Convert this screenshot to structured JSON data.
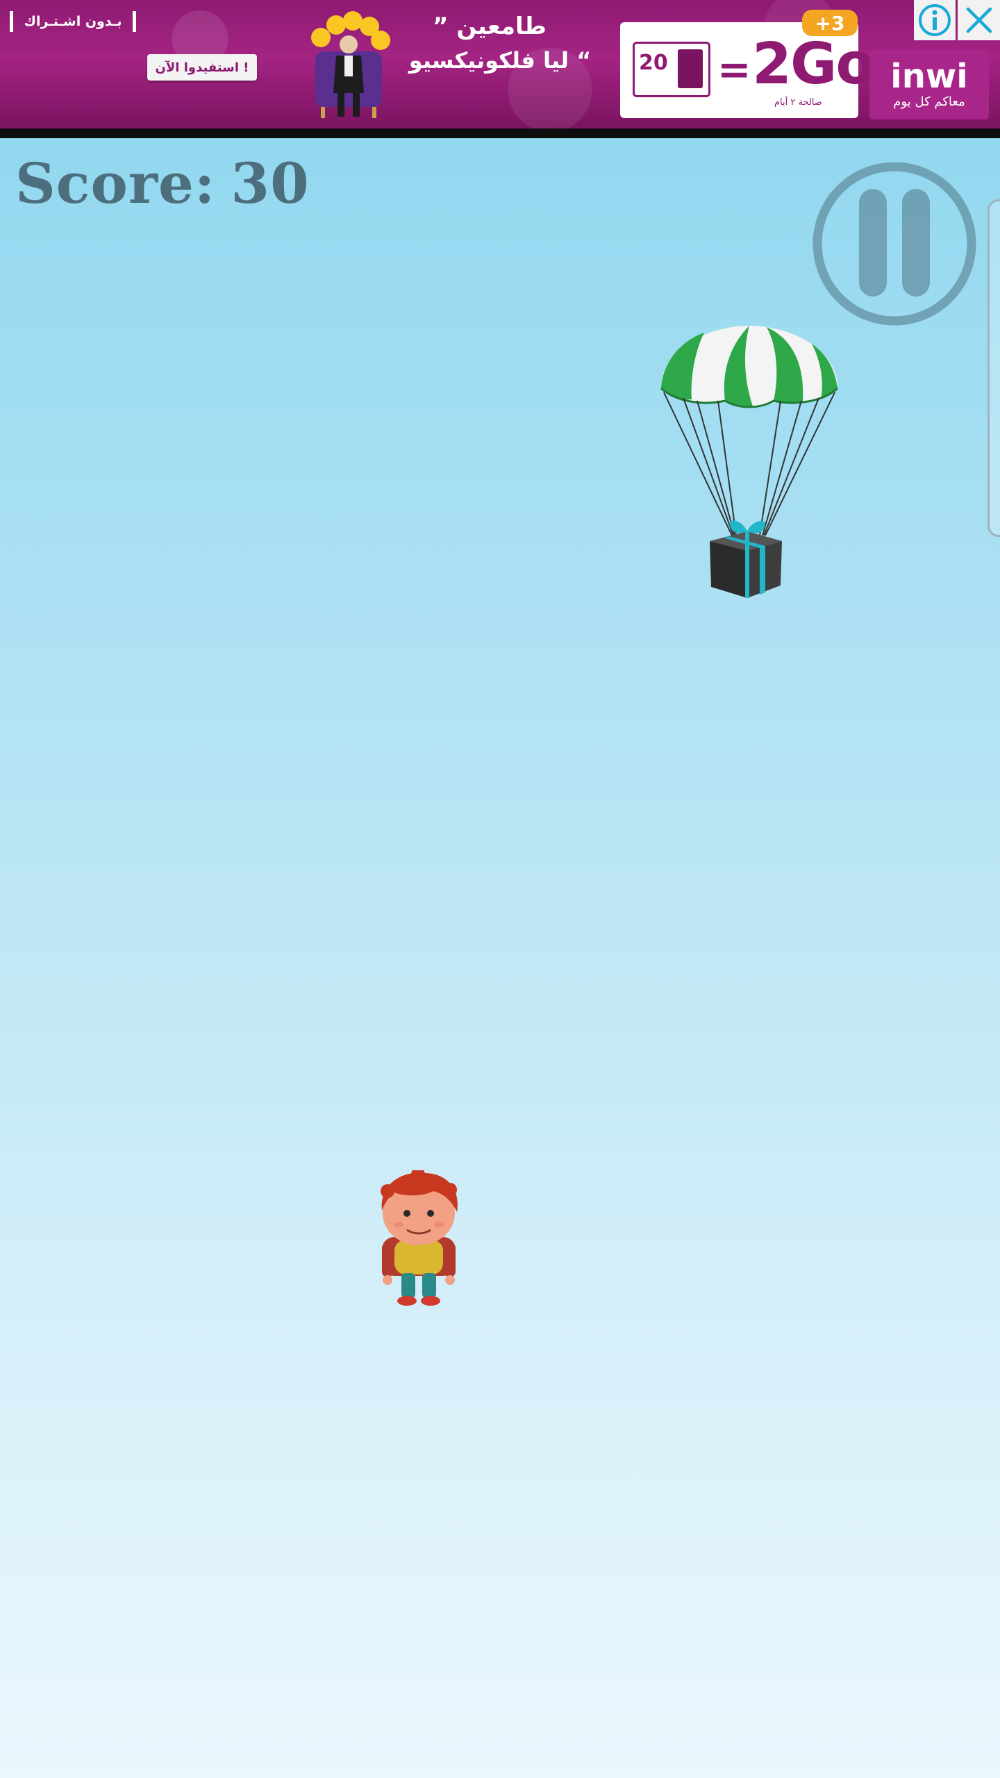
{
  "ad": {
    "no_subscription": "بـدون اشـتـراك",
    "cta": "استفيدوا الآن !",
    "headline_1": "” طامعين",
    "headline_2": "ليا فلكونيكسيو “",
    "phone_value": "20",
    "offer": "2Go",
    "offer_eq": "=",
    "days": "صالحة ٢ أيام",
    "bonus": "+3",
    "brand": "inwi",
    "brand_tagline": "معاكم كل يوم",
    "info_icon": "info-icon",
    "close_icon": "close-icon"
  },
  "hud": {
    "score_label": "Score:",
    "score_value": "30",
    "pause_icon": "pause-icon"
  },
  "scene": {
    "falling_item": "parachute-gift",
    "player": "red-haired-kid",
    "colors": {
      "sky_top": "#92d8f0",
      "sky_bottom": "#eaf7fd",
      "score_text": "#4d6e7d",
      "parachute_green": "#2fa84a",
      "gift_box": "#2b2b2b",
      "gift_ribbon": "#1fb7c9",
      "ad_magenta": "#a42483"
    }
  }
}
